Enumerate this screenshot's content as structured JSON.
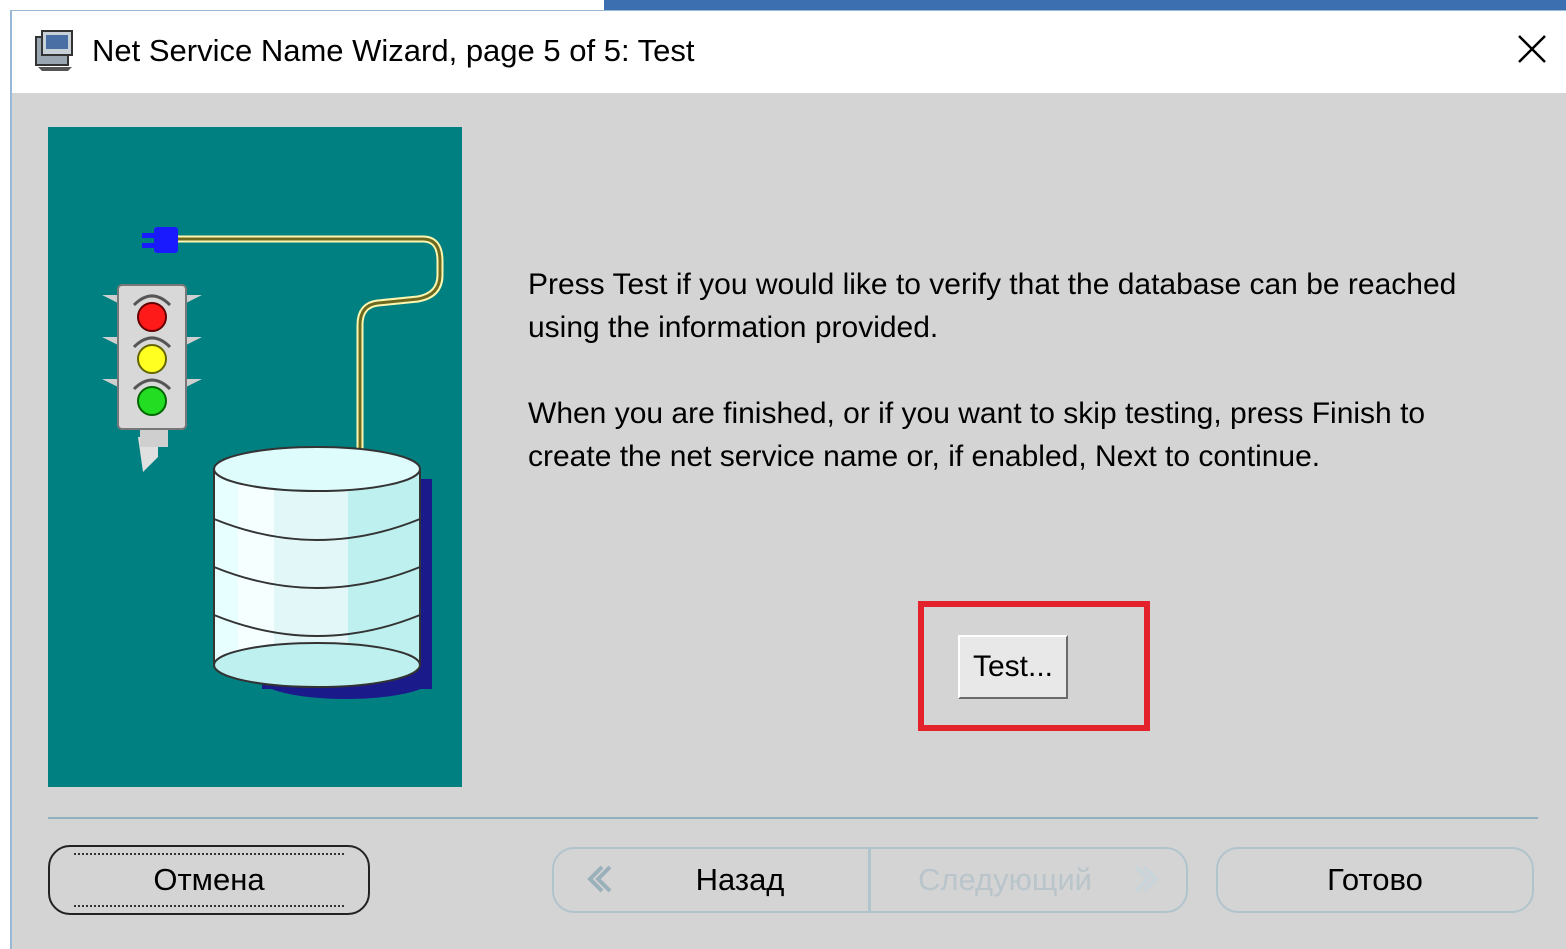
{
  "window": {
    "title": "Net Service Name Wizard, page 5 of 5: Test",
    "app_icon": "wizard-icon",
    "close_icon": "close-icon"
  },
  "illustration": {
    "background": "#008080",
    "icons": [
      "traffic-light-icon",
      "database-icon",
      "plug-icon"
    ]
  },
  "content": {
    "paragraph1": "Press Test if you would like to verify that the database can be reached using the information provided.",
    "paragraph2": "When you are finished, or if you want to skip testing, press Finish to create the net service name or, if enabled, Next to continue.",
    "test_button": "Test...",
    "highlight_color": "#e3222b"
  },
  "footer": {
    "cancel": "Отмена",
    "back": "Назад",
    "next": "Следующий",
    "finish": "Готово",
    "next_enabled": false
  }
}
